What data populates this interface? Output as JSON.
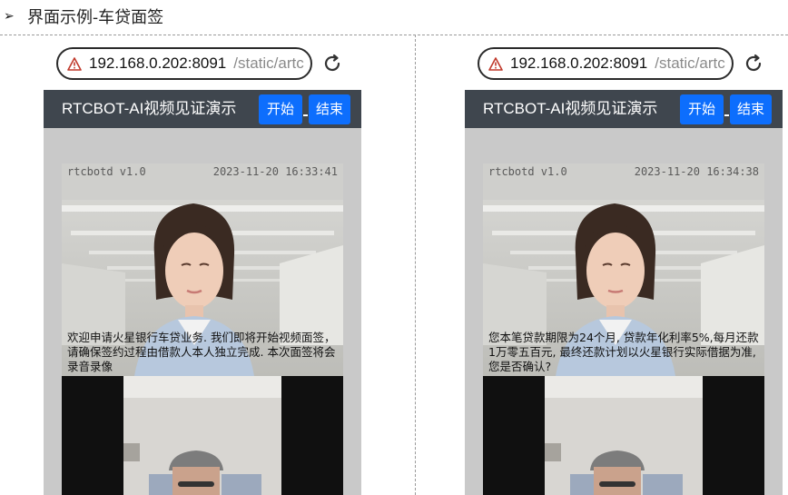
{
  "section": {
    "bullet": "➢",
    "title": "界面示例-车贷面签"
  },
  "screens": [
    {
      "url_host": "192.168.0.202:8091",
      "url_path": "/static/artc",
      "app_title": "RTCBOT-AI视频见证演示",
      "start_label": "开始",
      "end_label": "结束",
      "overlay_version": "rtcbotd v1.0",
      "overlay_time": "2023-11-20 16:33:41",
      "subtitle": "欢迎申请火星银行车贷业务. 我们即将开始视频面签，请确保签约过程由借款人本人独立完成. 本次面签将会录音录像"
    },
    {
      "url_host": "192.168.0.202:8091",
      "url_path": "/static/artc",
      "app_title": "RTCBOT-AI视频见证演示",
      "start_label": "开始",
      "end_label": "结束",
      "overlay_version": "rtcbotd v1.0",
      "overlay_time": "2023-11-20 16:34:38",
      "subtitle": "您本笔贷款期限为24个月, 贷款年化利率5%,每月还款1万零五百元, 最终还款计划以火星银行实际借据为准, 您是否确认?"
    }
  ],
  "colors": {
    "appbar": "#3f464e",
    "button": "#0d6efd",
    "video_bg": "#c9c9c9",
    "warning": "#c0392b"
  },
  "icons": {
    "warning": "warning-triangle-icon",
    "reload": "reload-icon"
  }
}
